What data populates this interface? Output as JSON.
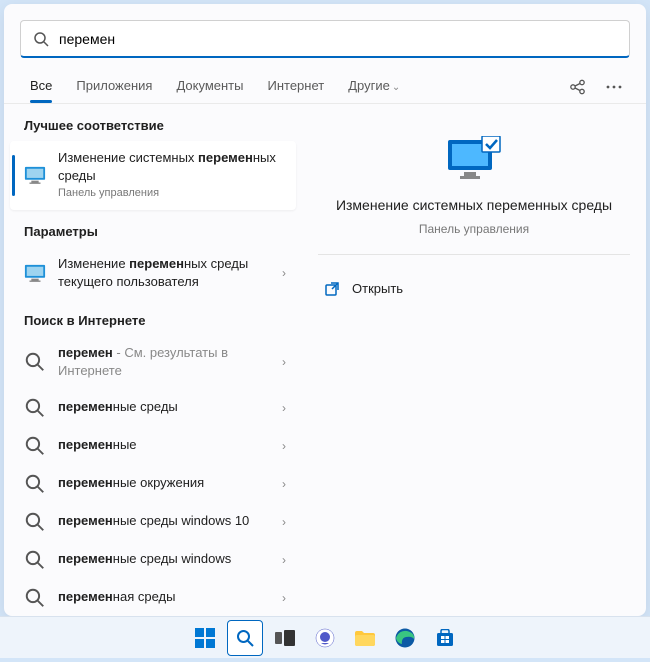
{
  "search": {
    "value": "перемен"
  },
  "tabs": {
    "all": "Все",
    "apps": "Приложения",
    "docs": "Документы",
    "web": "Интернет",
    "more": "Другие"
  },
  "sections": {
    "best": "Лучшее соответствие",
    "settings": "Параметры",
    "web": "Поиск в Интернете"
  },
  "best": {
    "title_pre": "Изменение системных ",
    "title_hl": "перемен",
    "title_post": "ных среды",
    "sub": "Панель управления"
  },
  "settings_item": {
    "pre": "Изменение ",
    "hl": "перемен",
    "post": "ных среды текущего пользователя"
  },
  "websearch": [
    {
      "pre": "",
      "hl": "перемен",
      "post": "",
      "suffix": " - См. результаты в Интернете"
    },
    {
      "pre": "",
      "hl": "перемен",
      "post": "ные среды",
      "suffix": ""
    },
    {
      "pre": "",
      "hl": "перемен",
      "post": "ные",
      "suffix": ""
    },
    {
      "pre": "",
      "hl": "перемен",
      "post": "ные окружения",
      "suffix": ""
    },
    {
      "pre": "",
      "hl": "перемен",
      "post": "ные среды windows 10",
      "suffix": ""
    },
    {
      "pre": "",
      "hl": "перемен",
      "post": "ные среды windows",
      "suffix": ""
    },
    {
      "pre": "",
      "hl": "перемен",
      "post": "ная среды",
      "suffix": ""
    }
  ],
  "detail": {
    "title": "Изменение системных переменных среды",
    "sub": "Панель управления",
    "open": "Открыть"
  }
}
